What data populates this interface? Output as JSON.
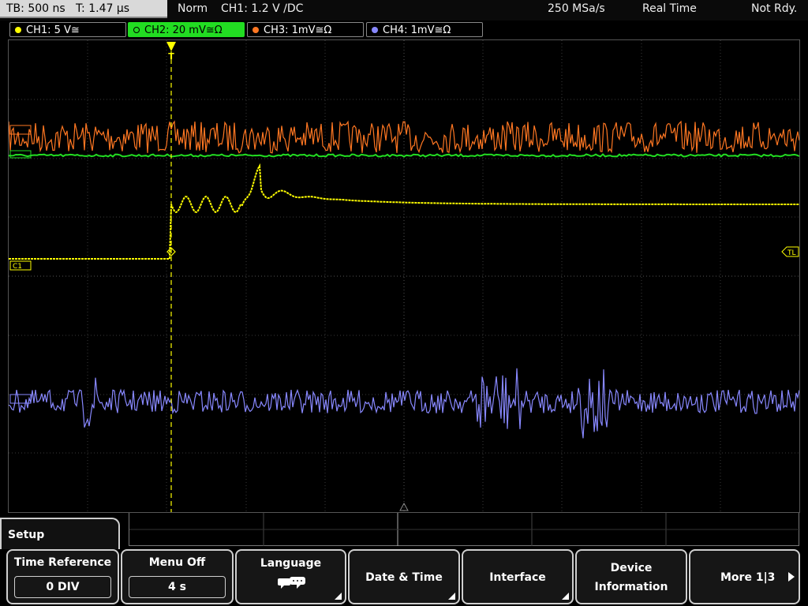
{
  "topbar": {
    "tb": "TB: 500 ns",
    "t": "T: 1.47 µs",
    "mode": "Norm",
    "trigger": "CH1: 1.2 V ∕DC",
    "sample_rate": "250 MSa/s",
    "acq_mode": "Real Time",
    "status": "Not Rdy."
  },
  "channels": [
    {
      "label": "CH1: 5 V≅",
      "color": "#ffff00"
    },
    {
      "label": "CH2: 20 mV≅Ω",
      "color": "#22dd22"
    },
    {
      "label": "CH3: 1mV≅Ω",
      "color": "#ff7722"
    },
    {
      "label": "CH4: 1mV≅Ω",
      "color": "#8888ff"
    }
  ],
  "markers": {
    "c1": "C1",
    "tl": "TL",
    "trigger_t": "T"
  },
  "colors": {
    "ch1": "#ffff00",
    "ch2": "#22dd22",
    "ch3": "#ff7722",
    "ch4": "#8888ff",
    "grid": "#3a3a3a"
  },
  "menu": {
    "title": "Setup",
    "time_reference": {
      "label": "Time Reference",
      "value": "0 DIV"
    },
    "menu_off": {
      "label": "Menu Off",
      "value": "4 s"
    },
    "language": {
      "label": "Language",
      "icon": "speech-bubbles-icon"
    },
    "date_time": {
      "label": "Date & Time"
    },
    "interface": {
      "label": "Interface"
    },
    "device_info": {
      "label_1": "Device",
      "label_2": "Information"
    },
    "more": {
      "label": "More 1|3",
      "icon": "arrow-right-icon"
    }
  }
}
